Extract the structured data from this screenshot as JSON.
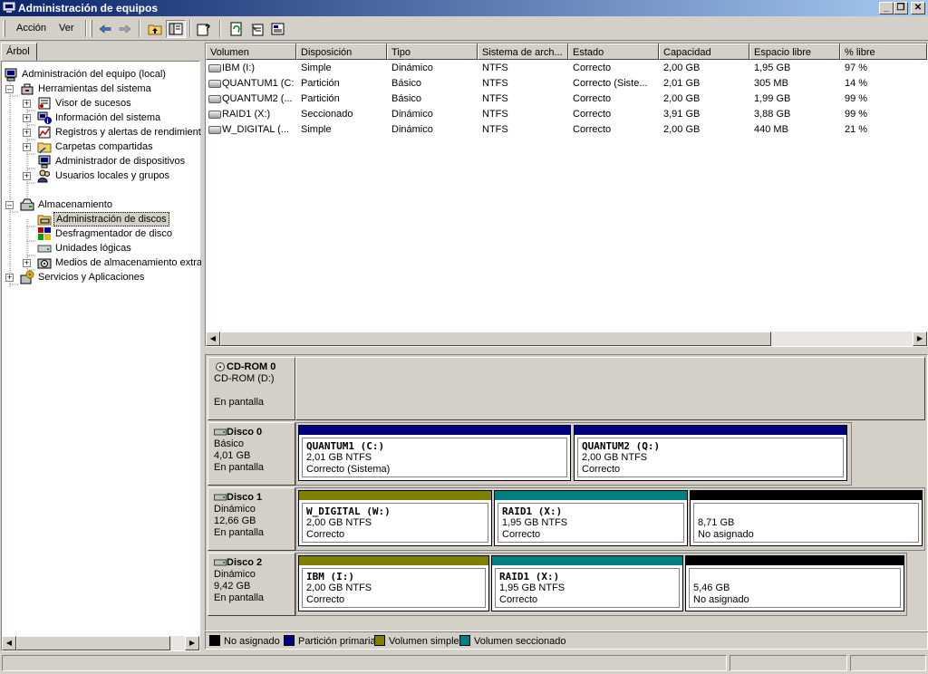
{
  "window": {
    "title": "Administración de equipos",
    "controls": {
      "minimize": "_",
      "maximize": "❐",
      "close": "✕"
    }
  },
  "menu": {
    "action": "Acción",
    "view": "Ver"
  },
  "toolbar": {
    "icons": [
      "back-arrow-icon",
      "forward-arrow-icon",
      "up-folder-icon",
      "show-tree-icon",
      "help-icon",
      "refresh-icon",
      "properties-icon",
      "export-icon"
    ]
  },
  "tree": {
    "tab_label": "Árbol",
    "root": "Administración del equipo (local)",
    "system_tools": "Herramientas del sistema",
    "event_viewer": "Visor de sucesos",
    "system_info": "Información del sistema",
    "perf_logs": "Registros y alertas de rendimient",
    "shared_folders": "Carpetas compartidas",
    "device_manager": "Administrador de dispositivos",
    "local_users": "Usuarios locales y grupos",
    "storage": "Almacenamiento",
    "disk_management": "Administración de discos",
    "defrag": "Desfragmentador de disco",
    "logical_drives": "Unidades lógicas",
    "removable_storage": "Medios de almacenamiento extrai",
    "services_apps": "Servicios y Aplicaciones"
  },
  "volume_list": {
    "columns": [
      "Volumen",
      "Disposición",
      "Tipo",
      "Sistema de arch...",
      "Estado",
      "Capacidad",
      "Espacio libre",
      "% libre"
    ],
    "rows": [
      [
        "IBM (I:)",
        "Simple",
        "Dinámico",
        "NTFS",
        "Correcto",
        "2,00 GB",
        "1,95 GB",
        "97 %"
      ],
      [
        "QUANTUM1 (C:)",
        "Partición",
        "Básico",
        "NTFS",
        "Correcto (Siste...",
        "2,01 GB",
        "305 MB",
        "14 %"
      ],
      [
        "QUANTUM2 (...",
        "Partición",
        "Básico",
        "NTFS",
        "Correcto",
        "2,00 GB",
        "1,99 GB",
        "99 %"
      ],
      [
        "RAID1 (X:)",
        "Seccionado",
        "Dinámico",
        "NTFS",
        "Correcto",
        "3,91 GB",
        "3,88 GB",
        "99 %"
      ],
      [
        "W_DIGITAL (...",
        "Simple",
        "Dinámico",
        "NTFS",
        "Correcto",
        "2,00 GB",
        "440 MB",
        "21 %"
      ]
    ],
    "scroll_fraction": 0.99
  },
  "disks": {
    "cdrom": {
      "name": "CD-ROM 0",
      "drive": "CD-ROM (D:)",
      "status": "En pantalla"
    },
    "disk0": {
      "name": "Disco 0",
      "type": "Básico",
      "size": "4,01 GB",
      "status": "En pantalla",
      "p1": {
        "name": "QUANTUM1  (C:)",
        "size": "2,01 GB NTFS",
        "status": "Correcto (Sistema)"
      },
      "p2": {
        "name": "QUANTUM2  (Q:)",
        "size": "2,00 GB NTFS",
        "status": "Correcto"
      }
    },
    "disk1": {
      "name": "Disco 1",
      "type": "Dinámico",
      "size": "12,66 GB",
      "status": "En pantalla",
      "p1": {
        "name": "W_DIGITAL  (W:)",
        "size": "2,00 GB NTFS",
        "status": "Correcto"
      },
      "p2": {
        "name": "RAID1  (X:)",
        "size": "1,95 GB NTFS",
        "status": "Correcto"
      },
      "p3": {
        "size": "8,71 GB",
        "status": "No asignado"
      }
    },
    "disk2": {
      "name": "Disco 2",
      "type": "Dinámico",
      "size": "9,42 GB",
      "status": "En pantalla",
      "p1": {
        "name": "IBM  (I:)",
        "size": "2,00 GB NTFS",
        "status": "Correcto"
      },
      "p2": {
        "name": "RAID1  (X:)",
        "size": "1,95 GB NTFS",
        "status": "Correcto"
      },
      "p3": {
        "size": "5,46 GB",
        "status": "No asignado"
      }
    }
  },
  "legend": {
    "unallocated": "No asignado",
    "primary": "Partición primaria",
    "simple": "Volumen simple",
    "striped": "Volumen seccionado"
  },
  "colors": {
    "unallocated": "#000000",
    "primary": "#00007f",
    "simple": "#808000",
    "striped": "#008080",
    "title_start": "#0a246a",
    "title_end": "#a6caf0"
  }
}
